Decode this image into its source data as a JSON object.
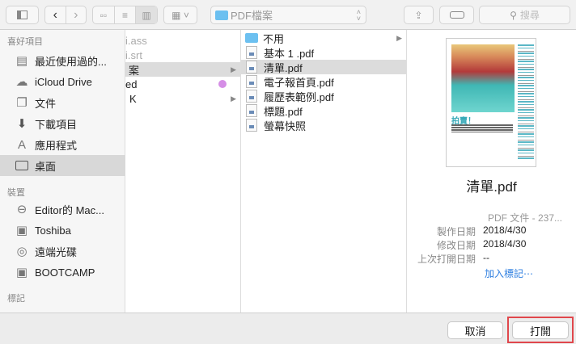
{
  "toolbar": {
    "location": "PDF檔案",
    "search_placeholder": "搜尋"
  },
  "sidebar": {
    "favorites_header": "喜好項目",
    "favorites": [
      {
        "label": "最近使用過的..."
      },
      {
        "label": "iCloud Drive"
      },
      {
        "label": "文件"
      },
      {
        "label": "下載項目"
      },
      {
        "label": "應用程式"
      },
      {
        "label": "桌面"
      }
    ],
    "devices_header": "裝置",
    "devices": [
      {
        "label": "Editor的 Mac..."
      },
      {
        "label": "Toshiba"
      },
      {
        "label": "遠端光碟"
      },
      {
        "label": "BOOTCAMP"
      }
    ],
    "tags_header": "標記"
  },
  "column1": {
    "items": [
      {
        "label": "i.ass"
      },
      {
        "label": "i.srt"
      },
      {
        "label": "案"
      },
      {
        "label": "ed"
      },
      {
        "label": "K"
      }
    ],
    "tag_color": "#d58ee6"
  },
  "column2": {
    "items": [
      {
        "label": "不用"
      },
      {
        "label": "基本 1 .pdf"
      },
      {
        "label": "清單.pdf"
      },
      {
        "label": "電子報首頁.pdf"
      },
      {
        "label": "履歷表範例.pdf"
      },
      {
        "label": "標題.pdf"
      },
      {
        "label": "螢幕快照"
      }
    ]
  },
  "preview": {
    "thumb_title": "拍賣！",
    "filename": "清單.pdf",
    "kind": "PDF 文件 - 237...",
    "created_label": "製作日期",
    "created": "2018/4/30",
    "modified_label": "修改日期",
    "modified": "2018/4/30",
    "opened_label": "上次打開日期",
    "opened": "--",
    "add_tags": "加入標記⋯"
  },
  "buttons": {
    "cancel": "取消",
    "open": "打開"
  },
  "colors": {
    "highlight": "#e0474c",
    "accent": "#2f7fe0"
  }
}
